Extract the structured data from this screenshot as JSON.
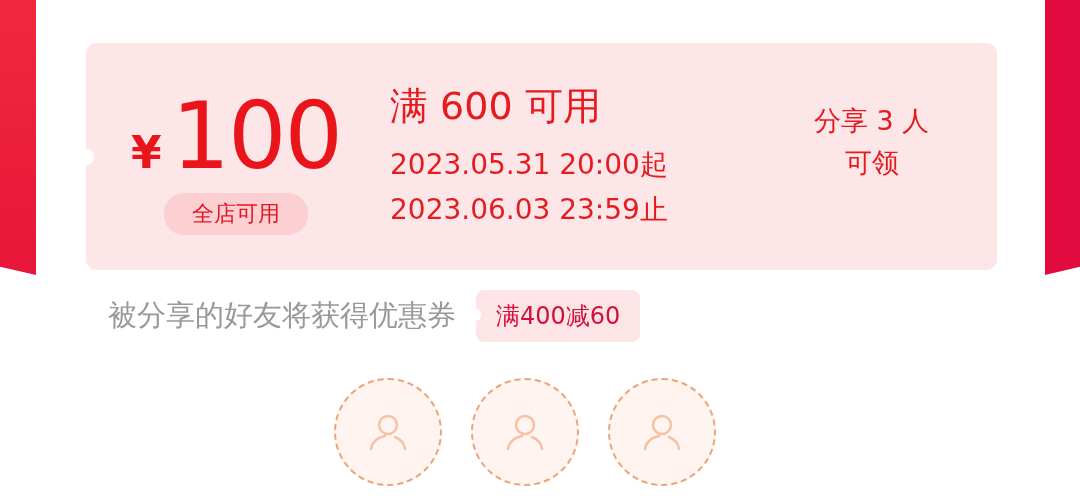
{
  "coupon": {
    "currency": "¥",
    "amount": "100",
    "scope": "全店可用",
    "threshold": "满 600 可用",
    "start": "2023.05.31 20:00起",
    "end": "2023.06.03 23:59止",
    "claim_line_1": "分享 3 人",
    "claim_line_2": "可领"
  },
  "friend_reward": {
    "text": "被分享的好友将获得优惠券",
    "tag": "满400减60"
  },
  "invite_slots": [
    {
      "kind": "empty"
    },
    {
      "kind": "empty"
    },
    {
      "kind": "empty"
    }
  ]
}
